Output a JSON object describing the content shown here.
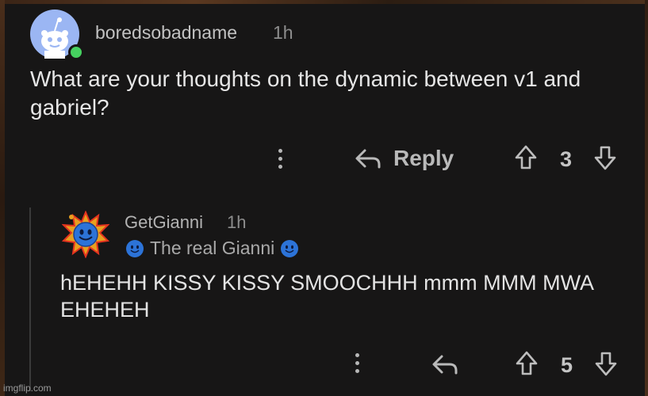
{
  "post": {
    "username": "boredsobadname",
    "time": "1h",
    "body": "What are your thoughts on the dynamic between v1 and gabriel?",
    "reply_label": "Reply",
    "score": "3"
  },
  "reply": {
    "username": "GetGianni",
    "time": "1h",
    "flair": "The real Gianni",
    "body": "hEHEHH KISSY KISSY SMOOCHHH mmm MMM MWA EHEHEH",
    "score": "5"
  },
  "watermark": "imgflip.com",
  "colors": {
    "background": "#171616",
    "online": "#46d160",
    "avatar_blue": "#9bb6f3"
  },
  "icons": [
    "snoo-avatar-icon",
    "online-status-icon",
    "more-options-icon",
    "reply-arrow-icon",
    "upvote-icon",
    "downvote-icon",
    "sun-avatar-icon",
    "blue-smiley-icon"
  ]
}
